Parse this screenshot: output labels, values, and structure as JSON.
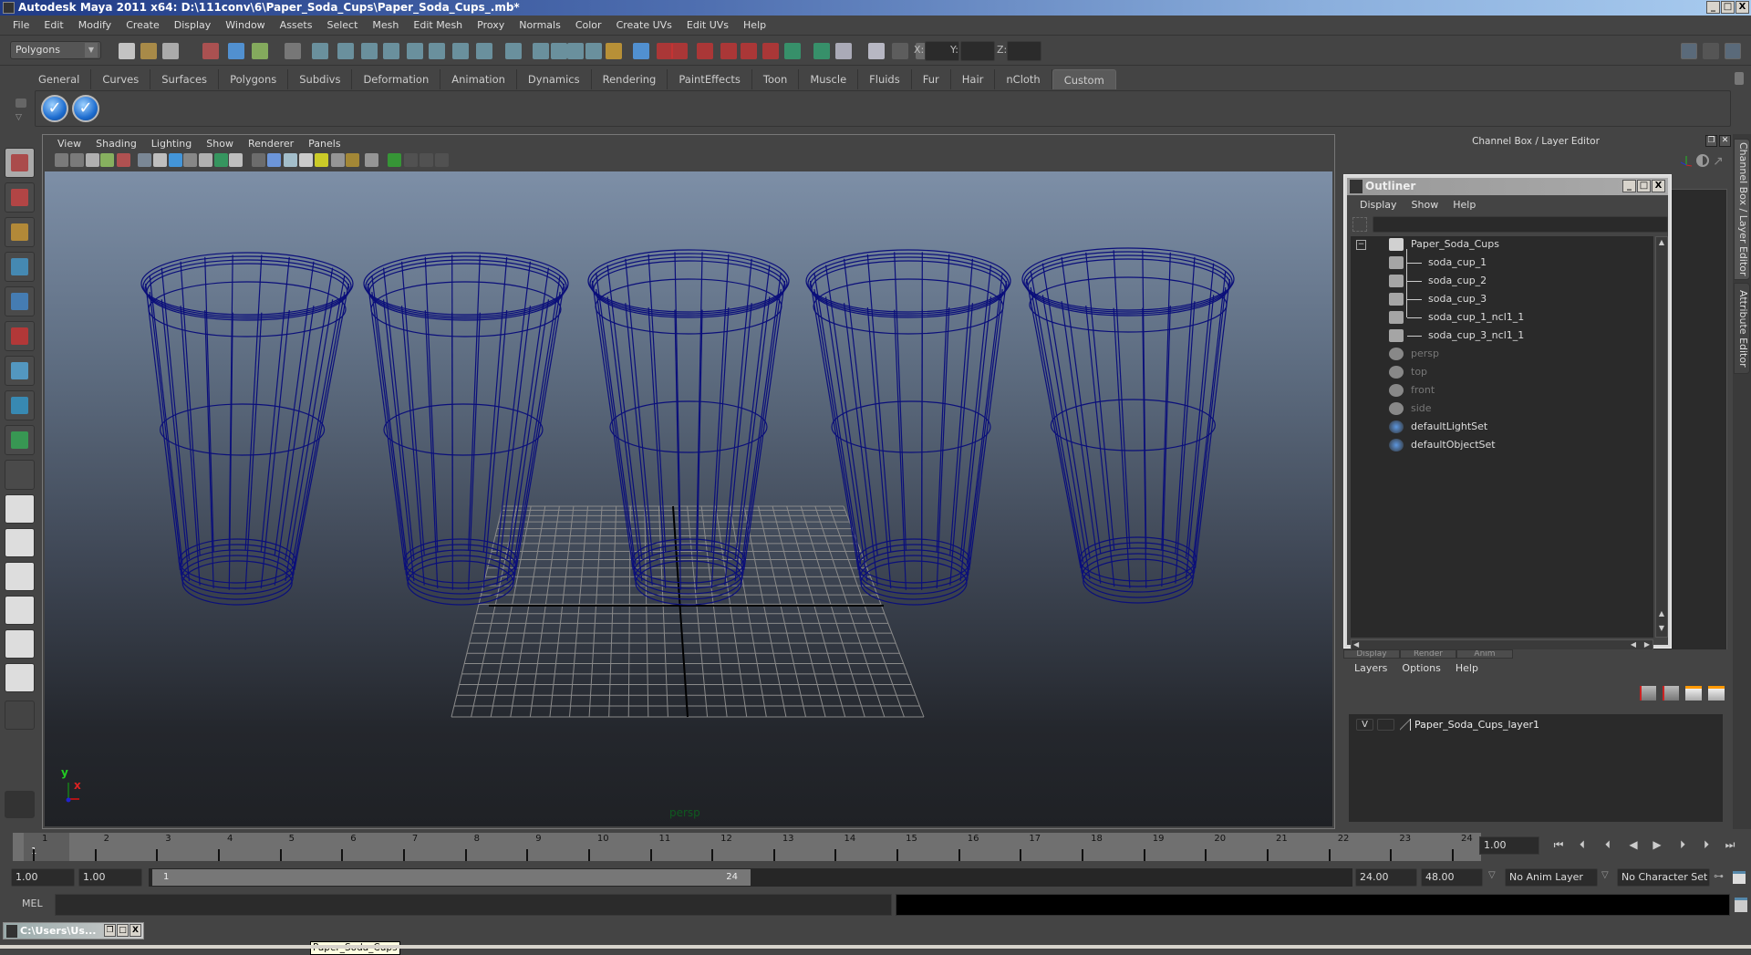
{
  "window": {
    "title": "Autodesk Maya 2011 x64: D:\\111conv\\6\\Paper_Soda_Cups\\Paper_Soda_Cups_.mb*",
    "controls": [
      "_",
      "□",
      "X"
    ]
  },
  "menubar": [
    "File",
    "Edit",
    "Modify",
    "Create",
    "Display",
    "Window",
    "Assets",
    "Select",
    "Mesh",
    "Edit Mesh",
    "Proxy",
    "Normals",
    "Color",
    "Create UVs",
    "Edit UVs",
    "Help"
  ],
  "statusline": {
    "mode": "Polygons",
    "x_label": "X:",
    "y_label": "Y:",
    "z_label": "Z:",
    "x_value": "",
    "y_value": "",
    "z_value": ""
  },
  "shelf": {
    "tabs": [
      "General",
      "Curves",
      "Surfaces",
      "Polygons",
      "Subdivs",
      "Deformation",
      "Animation",
      "Dynamics",
      "Rendering",
      "PaintEffects",
      "Toon",
      "Muscle",
      "Fluids",
      "Fur",
      "Hair",
      "nCloth",
      "Custom"
    ],
    "active_tab": "Custom",
    "buttons": [
      "check-button-1",
      "check-button-2"
    ]
  },
  "viewport": {
    "menu": [
      "View",
      "Shading",
      "Lighting",
      "Show",
      "Renderer",
      "Panels"
    ],
    "camera_label": "persp",
    "axis": {
      "y": "y",
      "x": "x"
    },
    "objects": [
      "soda_cup_1",
      "soda_cup_2",
      "soda_cup_3",
      "soda_cup_1_ncl1_1",
      "soda_cup_3_ncl1_1"
    ],
    "wire_color": "#0b0f7a"
  },
  "channel_box": {
    "title": "Channel Box / Layer Editor",
    "side_tabs": [
      "Channel Box / Layer Editor",
      "Attribute Editor"
    ]
  },
  "outliner": {
    "title": "Outliner",
    "menu": [
      "Display",
      "Show",
      "Help"
    ],
    "filter_value": "",
    "items": [
      {
        "label": "Paper_Soda_Cups",
        "type": "group",
        "dim": false,
        "level": 0
      },
      {
        "label": "soda_cup_1",
        "type": "mesh",
        "dim": false,
        "level": 1
      },
      {
        "label": "soda_cup_2",
        "type": "mesh",
        "dim": false,
        "level": 1
      },
      {
        "label": "soda_cup_3",
        "type": "mesh",
        "dim": false,
        "level": 1
      },
      {
        "label": "soda_cup_1_ncl1_1",
        "type": "mesh",
        "dim": false,
        "level": 1
      },
      {
        "label": "soda_cup_3_ncl1_1",
        "type": "mesh",
        "dim": false,
        "level": 1
      },
      {
        "label": "persp",
        "type": "camera",
        "dim": true,
        "level": 0
      },
      {
        "label": "top",
        "type": "camera",
        "dim": true,
        "level": 0
      },
      {
        "label": "front",
        "type": "camera",
        "dim": true,
        "level": 0
      },
      {
        "label": "side",
        "type": "camera",
        "dim": true,
        "level": 0
      },
      {
        "label": "defaultLightSet",
        "type": "set",
        "dim": false,
        "level": 0
      },
      {
        "label": "defaultObjectSet",
        "type": "set",
        "dim": false,
        "level": 0
      }
    ]
  },
  "layer_editor": {
    "tabs": [
      "Display",
      "Render",
      "Anim"
    ],
    "menu": [
      "Layers",
      "Options",
      "Help"
    ],
    "layers": [
      {
        "visible": "V",
        "name": "Paper_Soda_Cups_layer1"
      }
    ]
  },
  "timeline": {
    "ticks": [
      "1",
      "2",
      "3",
      "4",
      "5",
      "6",
      "7",
      "8",
      "9",
      "10",
      "11",
      "12",
      "13",
      "14",
      "15",
      "16",
      "17",
      "18",
      "19",
      "20",
      "21",
      "22",
      "23",
      "24"
    ],
    "current_frame_marker": "1",
    "current_frame": "1.00"
  },
  "range": {
    "start": "1.00",
    "playback_start": "1.00",
    "slider_start": "1",
    "slider_end": "24",
    "playback_end": "24.00",
    "end": "48.00",
    "anim_layer": "No Anim Layer",
    "character_set": "No Character Set"
  },
  "command_line": {
    "label": "MEL",
    "value": ""
  },
  "taskbar": {
    "item": "C:\\Users\\Us...",
    "tooltip": "Paper_Soda_Cups"
  }
}
